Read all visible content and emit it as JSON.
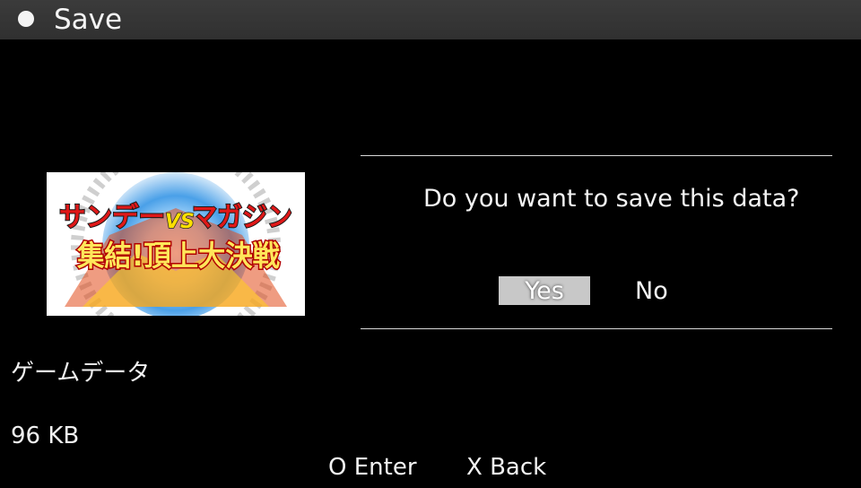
{
  "header": {
    "title": "Save",
    "background_color": "#333333"
  },
  "save_data": {
    "name": "ゲームデータ",
    "size": "96 KB",
    "thumbnail": {
      "title_part_1": "サンデー",
      "vs": "VS",
      "title_part_2": "マガジン",
      "subtitle": "集結!頂上大決戦"
    }
  },
  "dialog": {
    "question": "Do you want to save this data?",
    "yes_label": "Yes",
    "no_label": "No",
    "selected": "Yes",
    "selected_color": "#c8c8c8"
  },
  "footer": {
    "enter_hint": "O Enter",
    "back_hint": "X Back"
  }
}
